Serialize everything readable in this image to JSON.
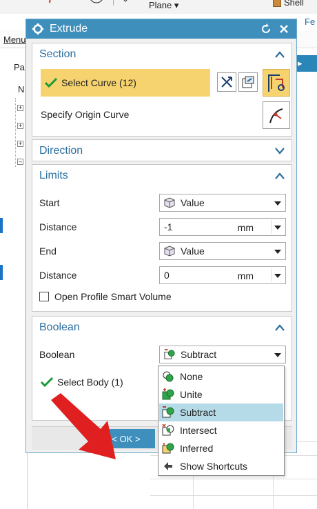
{
  "background": {
    "plane_label": "Plane ▾",
    "shell_label": "Shell",
    "fe_label": "Fe",
    "menu_label": "Menu",
    "pa_label": "Pa",
    "n_label": "N",
    "tree_toggles": [
      "+",
      "+",
      "+",
      "–"
    ]
  },
  "dialog": {
    "title": "Extrude",
    "section": {
      "header": "Section",
      "select_curve": "Select Curve (12)",
      "specify_origin": "Specify Origin Curve"
    },
    "direction": {
      "header": "Direction"
    },
    "limits": {
      "header": "Limits",
      "start_label": "Start",
      "start_value": "Value",
      "distance1_label": "Distance",
      "distance1_value": "-1",
      "distance1_unit": "mm",
      "end_label": "End",
      "end_value": "Value",
      "distance2_label": "Distance",
      "distance2_value": "0",
      "distance2_unit": "mm",
      "open_profile_label": "Open Profile Smart Volume",
      "open_profile_checked": false
    },
    "boolean": {
      "header": "Boolean",
      "boolean_label": "Boolean",
      "boolean_value": "Subtract",
      "select_body": "Select Body (1)"
    },
    "ok_button": "< OK >"
  },
  "boolean_dropdown": {
    "options": [
      "None",
      "Unite",
      "Subtract",
      "Intersect",
      "Inferred",
      "Show Shortcuts"
    ],
    "selected": "Subtract"
  },
  "colors": {
    "title_bar": "#3e8fbc",
    "highlight": "#f6d36e",
    "group_header": "#2a6fa0",
    "selected_option": "#b6dbe8",
    "annotation_arrow": "#e02020"
  }
}
